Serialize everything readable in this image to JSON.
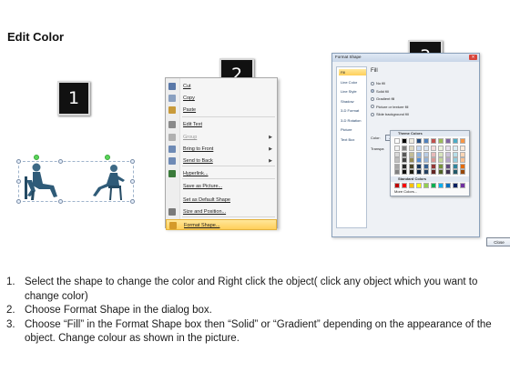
{
  "title": "Edit Color",
  "badges": [
    "1",
    "2",
    "3"
  ],
  "context_menu": {
    "items": [
      {
        "label": "Cut",
        "icon": "scissors-icon",
        "color": "#5a78a8"
      },
      {
        "label": "Copy",
        "icon": "copy-icon",
        "color": "#8aa0c0"
      },
      {
        "label": "Paste",
        "icon": "paste-icon",
        "color": "#c89a3a"
      },
      {
        "label": "Edit Text",
        "icon": "edit-text-icon",
        "color": "#8a8a8a"
      },
      {
        "label": "Group",
        "icon": "group-icon",
        "color": "#b0b0b0",
        "disabled": true,
        "submenu": true
      },
      {
        "label": "Bring to Front",
        "icon": "bring-front-icon",
        "color": "#6e8ab5",
        "submenu": true
      },
      {
        "label": "Send to Back",
        "icon": "send-back-icon",
        "color": "#6e8ab5",
        "submenu": true
      },
      {
        "label": "Hyperlink...",
        "icon": "hyperlink-icon",
        "color": "#3a7a3a"
      },
      {
        "label": "Save as Picture...",
        "icon": "",
        "color": ""
      },
      {
        "label": "Set as Default Shape",
        "icon": "",
        "color": ""
      },
      {
        "label": "Size and Position...",
        "icon": "size-position-icon",
        "color": "#7a7a7a"
      },
      {
        "label": "Format Shape...",
        "icon": "format-shape-icon",
        "color": "#d59a2a",
        "highlighted": true
      }
    ]
  },
  "dialog": {
    "title": "Format Shape",
    "categories": [
      "Fill",
      "Line Color",
      "Line Style",
      "Shadow",
      "3-D Format",
      "3-D Rotation",
      "Picture",
      "Text Box"
    ],
    "selected_category": "Fill",
    "pane_heading": "Fill",
    "fill_options": [
      {
        "label": "No fill",
        "selected": false
      },
      {
        "label": "Solid fill",
        "selected": true
      },
      {
        "label": "Gradient fill",
        "selected": false
      },
      {
        "label": "Picture or texture fill",
        "selected": false
      },
      {
        "label": "Slide background fill",
        "selected": false
      }
    ],
    "color_label": "Color:",
    "transparency_label": "Transpa",
    "close_label": "Close"
  },
  "palette": {
    "theme_header": "Theme Colors",
    "standard_header": "Standard Colors",
    "more_label": "More Colors...",
    "theme_top": [
      "#ffffff",
      "#000000",
      "#eeece1",
      "#1f497d",
      "#4f81bd",
      "#c0504d",
      "#9bbb59",
      "#8064a2",
      "#4bacc6",
      "#f79646"
    ],
    "theme_columns": [
      [
        "#f2f2f2",
        "#d9d9d9",
        "#bfbfbf",
        "#a6a6a6",
        "#808080"
      ],
      [
        "#7f7f7f",
        "#595959",
        "#404040",
        "#262626",
        "#0d0d0d"
      ],
      [
        "#ddd9c3",
        "#c4bd97",
        "#948a54",
        "#4a452a",
        "#1e1c11"
      ],
      [
        "#c6d9f1",
        "#8db3e2",
        "#548dd4",
        "#17365d",
        "#0f243e"
      ],
      [
        "#dbe5f1",
        "#b8cce4",
        "#95b3d7",
        "#366092",
        "#244061"
      ],
      [
        "#f2dcdb",
        "#e6b9b8",
        "#d99694",
        "#953735",
        "#632523"
      ],
      [
        "#ebf1de",
        "#d7e4bd",
        "#c3d69b",
        "#77933c",
        "#4f6228"
      ],
      [
        "#e6e0ec",
        "#ccc1da",
        "#b3a2c7",
        "#604a7b",
        "#3f3151"
      ],
      [
        "#dbeef4",
        "#b7dee8",
        "#93cddd",
        "#31859c",
        "#215968"
      ],
      [
        "#fdeada",
        "#fbd5b5",
        "#fac090",
        "#e46c0a",
        "#984807"
      ]
    ],
    "standard": [
      "#c00000",
      "#ff0000",
      "#ffc000",
      "#ffff00",
      "#92d050",
      "#00b050",
      "#00b0f0",
      "#0070c0",
      "#002060",
      "#7030a0"
    ]
  },
  "steps": [
    {
      "num": "1.",
      "text": "Select the shape to change the color and Right click the object( click any object which you want to change color)"
    },
    {
      "num": "2.",
      "text": "Choose Format Shape in the dialog box."
    },
    {
      "num": "3.",
      "text": "Choose “Fill” in the Format Shape box then “Solid” or “Gradient” depending on the appearance of the object. Change colour as shown in the picture."
    }
  ]
}
